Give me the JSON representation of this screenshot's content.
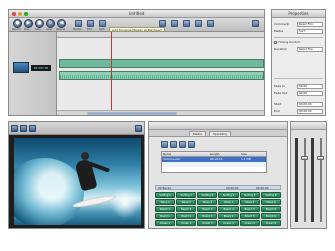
{
  "main_window": {
    "title": "Untitled",
    "toolbar": {
      "tooltip": "Add Timeline Marker at Playhead",
      "labels": [
        "Record",
        "Play",
        "Stop",
        "Loop",
        "Rewind",
        "Marker",
        "Edit",
        "Split"
      ]
    },
    "timeline": {
      "timecode": "00:00:00"
    }
  },
  "properties": {
    "title": "Properties",
    "rows": [
      {
        "label": "Comment",
        "value": "Rapid Fire"
      },
      {
        "label": "Media",
        "value": "Surf"
      },
      {
        "label": "Timing Control",
        "value": ""
      },
      {
        "label": "Duration",
        "value": "Rapid Fire"
      },
      {
        "label": "Fade In",
        "value": "00:00"
      },
      {
        "label": "Fade Out",
        "value": "00:00"
      },
      {
        "label": "Start",
        "value": "00:00:00"
      },
      {
        "label": "End",
        "value": "00:00:00"
      }
    ]
  },
  "media": {
    "tabs": [
      "Media",
      "Sparkling"
    ],
    "table": {
      "headers": [
        "Name",
        "Length",
        "Size"
      ],
      "rows": [
        [
          "Commander",
          "00:18:16",
          "1.4 MB"
        ],
        [
          "",
          "",
          ""
        ],
        [
          "",
          "",
          ""
        ]
      ]
    },
    "grid_header": [
      "60 Banks",
      "00:00:00",
      "00:00:00"
    ],
    "bank_labels": [
      "Surfing 1",
      "Surfing 2",
      "Surfing 3",
      "Surfing 4",
      "Surfing 5",
      "Surfing 6",
      "Wave 1",
      "Wave 2",
      "Wave 3",
      "Wave 4",
      "Wave 5",
      "Wave 6",
      "Beach 1",
      "Beach 2",
      "Beach 3",
      "Beach 4",
      "Beach 5",
      "Beach 6",
      "Board 1",
      "Board 2",
      "Board 3",
      "Board 4",
      "Board 5",
      "Board 6",
      "Ocean 1",
      "Ocean 2",
      "Ocean 3",
      "Ocean 4",
      "Ocean 5",
      "Ocean 6"
    ]
  },
  "colors": {
    "accent": "#3d6fc6",
    "bank_green": "#2f8d60",
    "clip_green": "#6fb89a"
  },
  "icons": [
    "traffic-lights",
    "play-icon",
    "stop-icon",
    "record-icon",
    "marker-icon",
    "film-icon",
    "folder-icon"
  ]
}
